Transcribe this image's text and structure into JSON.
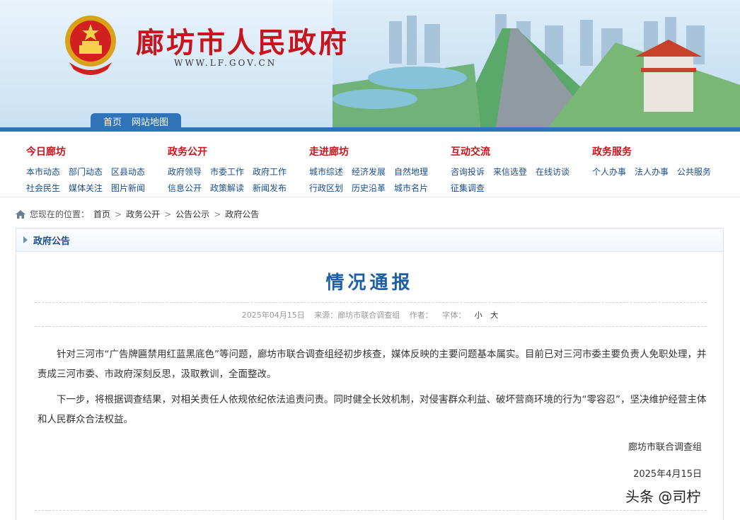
{
  "header": {
    "site_title": "廊坊市人民政府",
    "site_url": "WWW.LF.GOV.CN",
    "tabs": [
      "首页",
      "网站地图"
    ]
  },
  "nav": {
    "columns": [
      {
        "title": "今日廊坊",
        "links": [
          "本市动态",
          "部门动态",
          "区县动态",
          "社会民生",
          "媒体关注",
          "图片新闻"
        ]
      },
      {
        "title": "政务公开",
        "links": [
          "政府领导",
          "市委工作",
          "政府工作",
          "信息公开",
          "政策解读",
          "新闻发布"
        ]
      },
      {
        "title": "走进廊坊",
        "links": [
          "城市综述",
          "经济发展",
          "自然地理",
          "行政区划",
          "历史沿革",
          "城市名片"
        ]
      },
      {
        "title": "互动交流",
        "links": [
          "咨询投诉",
          "来信选登",
          "在线访谈",
          "征集调查"
        ]
      },
      {
        "title": "政务服务",
        "links": [
          "个人办事",
          "法人办事",
          "公共服务"
        ]
      }
    ]
  },
  "breadcrumb": {
    "prefix": "您现在的位置：",
    "items": [
      "首页",
      "政务公开",
      "公告公示",
      "政府公告"
    ],
    "separator": ">"
  },
  "panel": {
    "label": "政府公告"
  },
  "article": {
    "title": "情况通报",
    "date": "2025年04月15日",
    "source": "来源：廊坊市联合调查组",
    "author": "作者：",
    "font_size_label": "字体：",
    "font_small": "小",
    "font_large": "大",
    "paragraph1": "针对三河市“广告牌匾禁用红蓝黑底色”等问题，廊坊市联合调查组经初步核查，媒体反映的主要问题基本属实。目前已对三河市委主要负责人免职处理，并责成三河市委、市政府深刻反思，汲取教训，全面整改。",
    "paragraph2": "下一步，将根据调查结果，对相关责任人依规依纪依法追责问责。同时健全长效机制，对侵害群众利益、破坏营商环境的行为“零容忍”，坚决维护经营主体和人民群众合法权益。",
    "signature": "廊坊市联合调查组",
    "sign_date": "2025年4月15日"
  },
  "watermark": "头条 @司柠",
  "colors": {
    "title_red": "#c8151d",
    "link_blue": "#1a4f8e",
    "heading_blue": "#1f5fa3",
    "strip_blue": "#2f73b9"
  }
}
